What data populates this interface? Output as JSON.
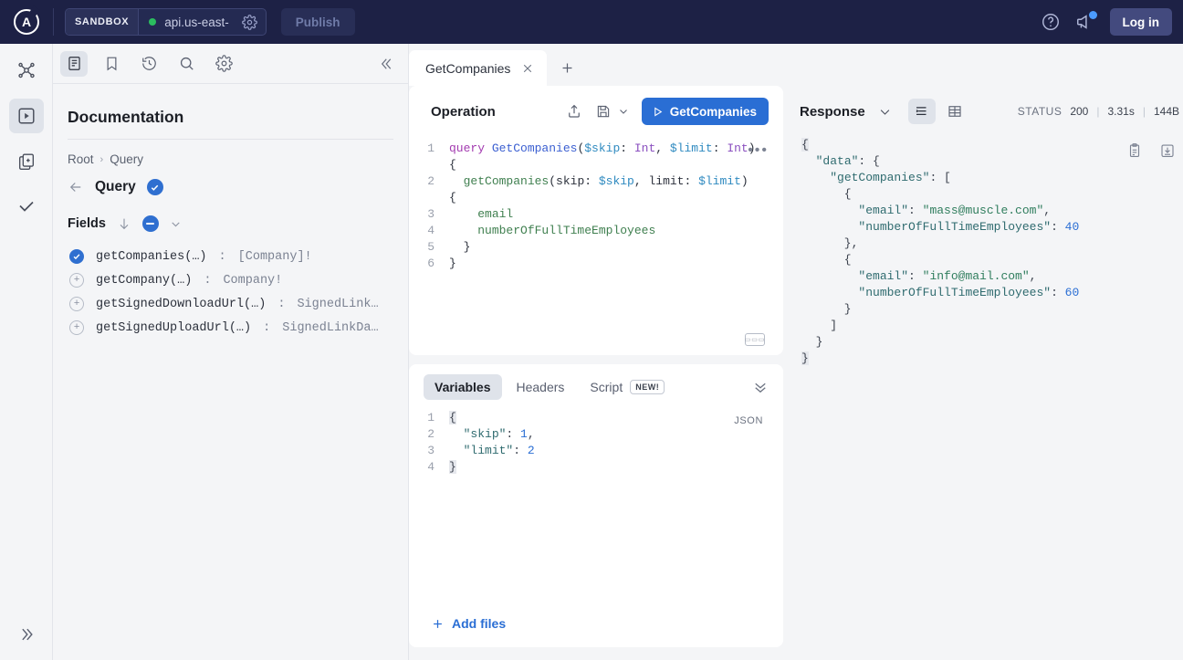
{
  "topbar": {
    "logo_letter": "A",
    "env_tag": "SANDBOX",
    "env_url": "api.us-east-",
    "publish_label": "Publish",
    "login_label": "Log in",
    "help_icon": "question-circle-icon",
    "announcements_icon": "megaphone-icon"
  },
  "rail": {
    "items": [
      {
        "name": "schema-graph-icon"
      },
      {
        "name": "explorer-icon"
      },
      {
        "name": "collections-icon"
      },
      {
        "name": "checks-icon"
      }
    ],
    "expand_label": "»"
  },
  "docs": {
    "toolbar": [
      {
        "name": "documentation-icon"
      },
      {
        "name": "bookmark-icon"
      },
      {
        "name": "history-icon"
      },
      {
        "name": "search-icon"
      },
      {
        "name": "settings-icon"
      }
    ],
    "collapse_label": "«",
    "title": "Documentation",
    "breadcrumb": {
      "root": "Root",
      "separator": "›",
      "current": "Query"
    },
    "type_name": "Query",
    "fields_label": "Fields",
    "fields": [
      {
        "state": "selected",
        "name": "getCompanies(…)",
        "sep": ": ",
        "type": "[Company]!"
      },
      {
        "state": "add",
        "name": "getCompany(…)",
        "sep": ": ",
        "type": "Company!"
      },
      {
        "state": "add",
        "name": "getSignedDownloadUrl(…)",
        "sep": ": ",
        "type": "SignedLink…"
      },
      {
        "state": "add",
        "name": "getSignedUploadUrl(…)",
        "sep": ": ",
        "type": "SignedLinkDa…"
      }
    ]
  },
  "tabs": {
    "items": [
      {
        "label": "GetCompanies",
        "close": "×"
      }
    ],
    "add_label": "+"
  },
  "operation": {
    "title": "Operation",
    "share_icon": "share-icon",
    "save_icon": "save-icon",
    "save_chevron_icon": "chevron-down-icon",
    "run_label": "GetCompanies",
    "run_icon": "play-icon",
    "ellipsis": "•••",
    "keyboard_hint": "⌨",
    "lines": [
      {
        "n": "1",
        "tokens": [
          {
            "t": "query ",
            "c": "kw"
          },
          {
            "t": "GetCompanies",
            "c": "opname"
          },
          {
            "t": "(",
            "c": ""
          },
          {
            "t": "$skip",
            "c": "var"
          },
          {
            "t": ": ",
            "c": ""
          },
          {
            "t": "Int",
            "c": "typ"
          },
          {
            "t": ", ",
            "c": ""
          },
          {
            "t": "$limit",
            "c": "var"
          },
          {
            "t": ": ",
            "c": ""
          },
          {
            "t": "Int",
            "c": "typ"
          },
          {
            "t": ") {",
            "c": ""
          }
        ]
      },
      {
        "n": "2",
        "tokens": [
          {
            "t": "  ",
            "c": ""
          },
          {
            "t": "getCompanies",
            "c": "fld"
          },
          {
            "t": "(skip: ",
            "c": ""
          },
          {
            "t": "$skip",
            "c": "var"
          },
          {
            "t": ", limit: ",
            "c": ""
          },
          {
            "t": "$limit",
            "c": "var"
          },
          {
            "t": ") {",
            "c": ""
          }
        ]
      },
      {
        "n": "3",
        "tokens": [
          {
            "t": "    ",
            "c": ""
          },
          {
            "t": "email",
            "c": "fld"
          }
        ]
      },
      {
        "n": "4",
        "tokens": [
          {
            "t": "    ",
            "c": ""
          },
          {
            "t": "numberOfFullTimeEmployees",
            "c": "fld"
          }
        ]
      },
      {
        "n": "5",
        "tokens": [
          {
            "t": "  }",
            "c": ""
          }
        ]
      },
      {
        "n": "6",
        "tokens": [
          {
            "t": "}",
            "c": ""
          }
        ]
      }
    ]
  },
  "variables": {
    "tabs": [
      {
        "label": "Variables",
        "active": true
      },
      {
        "label": "Headers",
        "active": false
      },
      {
        "label": "Script",
        "active": false,
        "badge": "NEW!"
      }
    ],
    "collapse_icon": "chevron-double-down-icon",
    "format_label": "JSON",
    "add_files_label": "Add files",
    "add_files_icon": "plus-icon",
    "lines": [
      {
        "n": "1",
        "tokens": [
          {
            "t": "{",
            "c": "jpunc brace-hl"
          }
        ]
      },
      {
        "n": "2",
        "tokens": [
          {
            "t": "  ",
            "c": ""
          },
          {
            "t": "\"skip\"",
            "c": "jkey"
          },
          {
            "t": ": ",
            "c": "jpunc"
          },
          {
            "t": "1",
            "c": "jnum"
          },
          {
            "t": ",",
            "c": "jpunc"
          }
        ]
      },
      {
        "n": "3",
        "tokens": [
          {
            "t": "  ",
            "c": ""
          },
          {
            "t": "\"limit\"",
            "c": "jkey"
          },
          {
            "t": ": ",
            "c": "jpunc"
          },
          {
            "t": "2",
            "c": "jnum"
          }
        ]
      },
      {
        "n": "4",
        "tokens": [
          {
            "t": "}",
            "c": "jpunc brace-hl"
          }
        ]
      }
    ]
  },
  "response": {
    "title": "Response",
    "chevron_icon": "chevron-down-icon",
    "views": [
      {
        "name": "json-view-icon",
        "active": true
      },
      {
        "name": "table-view-icon",
        "active": false
      }
    ],
    "copy_icon": "clipboard-icon",
    "download_icon": "download-icon",
    "status_label": "STATUS",
    "status_code": "200",
    "time": "3.31s",
    "size": "144B",
    "lines": [
      {
        "tokens": [
          {
            "t": "{",
            "c": "jpunc brace-hl"
          }
        ]
      },
      {
        "tokens": [
          {
            "t": "  ",
            "c": ""
          },
          {
            "t": "\"data\"",
            "c": "jkey"
          },
          {
            "t": ": {",
            "c": "jpunc"
          }
        ]
      },
      {
        "tokens": [
          {
            "t": "    ",
            "c": ""
          },
          {
            "t": "\"getCompanies\"",
            "c": "jkey"
          },
          {
            "t": ": [",
            "c": "jpunc"
          }
        ]
      },
      {
        "tokens": [
          {
            "t": "      {",
            "c": "jpunc"
          }
        ]
      },
      {
        "tokens": [
          {
            "t": "        ",
            "c": ""
          },
          {
            "t": "\"email\"",
            "c": "jkey"
          },
          {
            "t": ": ",
            "c": "jpunc"
          },
          {
            "t": "\"mass@muscle.com\"",
            "c": "jstr"
          },
          {
            "t": ",",
            "c": "jpunc"
          }
        ]
      },
      {
        "tokens": [
          {
            "t": "        ",
            "c": ""
          },
          {
            "t": "\"numberOfFullTimeEmployees\"",
            "c": "jkey"
          },
          {
            "t": ": ",
            "c": "jpunc"
          },
          {
            "t": "40",
            "c": "jnum"
          }
        ]
      },
      {
        "tokens": [
          {
            "t": "      },",
            "c": "jpunc"
          }
        ]
      },
      {
        "tokens": [
          {
            "t": "      {",
            "c": "jpunc"
          }
        ]
      },
      {
        "tokens": [
          {
            "t": "        ",
            "c": ""
          },
          {
            "t": "\"email\"",
            "c": "jkey"
          },
          {
            "t": ": ",
            "c": "jpunc"
          },
          {
            "t": "\"info@mail.com\"",
            "c": "jstr"
          },
          {
            "t": ",",
            "c": "jpunc"
          }
        ]
      },
      {
        "tokens": [
          {
            "t": "        ",
            "c": ""
          },
          {
            "t": "\"numberOfFullTimeEmployees\"",
            "c": "jkey"
          },
          {
            "t": ": ",
            "c": "jpunc"
          },
          {
            "t": "60",
            "c": "jnum"
          }
        ]
      },
      {
        "tokens": [
          {
            "t": "      }",
            "c": "jpunc"
          }
        ]
      },
      {
        "tokens": [
          {
            "t": "    ]",
            "c": "jpunc"
          }
        ]
      },
      {
        "tokens": [
          {
            "t": "  }",
            "c": "jpunc"
          }
        ]
      },
      {
        "tokens": [
          {
            "t": "}",
            "c": "jpunc brace-hl"
          }
        ]
      }
    ]
  },
  "colors": {
    "brand_dark": "#1d2145",
    "accent_blue": "#2a6ed4",
    "status_green": "#2bbd5f",
    "panel_bg": "#f4f5f7"
  }
}
